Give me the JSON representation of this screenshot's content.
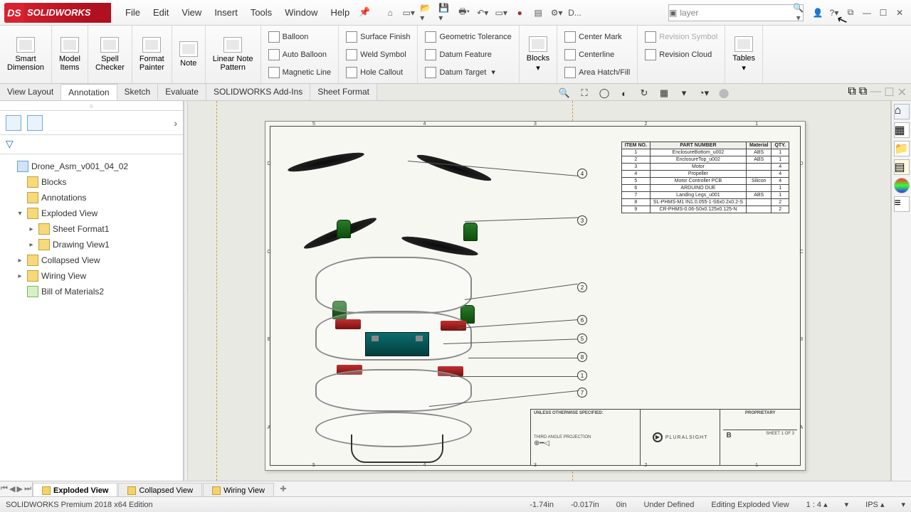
{
  "app": {
    "brand": "SOLIDWORKS"
  },
  "menu": [
    "File",
    "Edit",
    "View",
    "Insert",
    "Tools",
    "Window",
    "Help"
  ],
  "search": {
    "value": "layer"
  },
  "quick": {
    "d": "D..."
  },
  "ribbon": {
    "smartdim": "Smart\nDimension",
    "modelitems": "Model\nItems",
    "spell": "Spell\nChecker",
    "format": "Format\nPainter",
    "note": "Note",
    "linearnote": "Linear Note\nPattern",
    "blocks": "Blocks",
    "tables": "Tables",
    "balloon": "Balloon",
    "autoballoon": "Auto Balloon",
    "magline": "Magnetic Line",
    "surffin": "Surface Finish",
    "weldsym": "Weld Symbol",
    "holecall": "Hole Callout",
    "geotol": "Geometric Tolerance",
    "datumfeat": "Datum Feature",
    "datumtgt": "Datum Target",
    "ctrmark": "Center Mark",
    "ctrline": "Centerline",
    "revsym": "Revision Symbol",
    "revcloud": "Revision Cloud",
    "hatch": "Area Hatch/Fill"
  },
  "tabs": [
    "View Layout",
    "Annotation",
    "Sketch",
    "Evaluate",
    "SOLIDWORKS Add-Ins",
    "Sheet Format"
  ],
  "tree": {
    "root": "Drone_Asm_v001_04_02",
    "blocks": "Blocks",
    "annot": "Annotations",
    "exploded": "Exploded View",
    "sheetf": "Sheet Format1",
    "drawv": "Drawing View1",
    "collapsed": "Collapsed View",
    "wiring": "Wiring View",
    "bom": "Bill of Materials2"
  },
  "bomhead": {
    "item": "ITEM NO.",
    "part": "PART NUMBER",
    "mat": "Material",
    "qty": "QTY."
  },
  "bomrows": [
    {
      "n": "1",
      "p": "EnclosureBottom_u002",
      "m": "ABS",
      "q": "1"
    },
    {
      "n": "2",
      "p": "EnclosureTop_u002",
      "m": "ABS",
      "q": "1"
    },
    {
      "n": "3",
      "p": "Motor",
      "m": "",
      "q": "4"
    },
    {
      "n": "4",
      "p": "Propeller",
      "m": "",
      "q": "4"
    },
    {
      "n": "5",
      "p": "Motor Controller PCB",
      "m": "Silicon",
      "q": "4"
    },
    {
      "n": "6",
      "p": "ARDUINO DUE",
      "m": "",
      "q": "1"
    },
    {
      "n": "7",
      "p": "Landing Legs_u001",
      "m": "ABS",
      "q": "1"
    },
    {
      "n": "8",
      "p": "SL-PHMS-M1 IN1.0.055-1-S6x0.2x0.2-S",
      "m": "",
      "q": "2"
    },
    {
      "n": "9",
      "p": "CR-PHMS-0.06-S0x0.125x0.125-N",
      "m": "",
      "q": "2"
    }
  ],
  "rulers": {
    "top": [
      "5",
      "4",
      "3",
      "2",
      "1"
    ],
    "side": [
      "D",
      "C",
      "B",
      "A"
    ]
  },
  "markers": [
    "4",
    "3",
    "2",
    "6",
    "5",
    "8",
    "1",
    "7"
  ],
  "titleblock": {
    "notes": "UNLESS OTHERWISE SPECIFIED:",
    "proj": "THIRD ANGLE PROJECTION",
    "brand": "PLURALSIGHT",
    "prop": "PROPRIETARY",
    "size": "B",
    "sheet": "SHEET 1 OF 3"
  },
  "sheets": {
    "s1": "Exploded View",
    "s2": "Collapsed View",
    "s3": "Wiring View"
  },
  "status": {
    "edition": "SOLIDWORKS Premium 2018 x64 Edition",
    "x": "-1.74in",
    "y": "-0.017in",
    "z": "0in",
    "state": "Under Defined",
    "ctx": "Editing Exploded View",
    "scale": "1 : 4",
    "units": "IPS"
  }
}
